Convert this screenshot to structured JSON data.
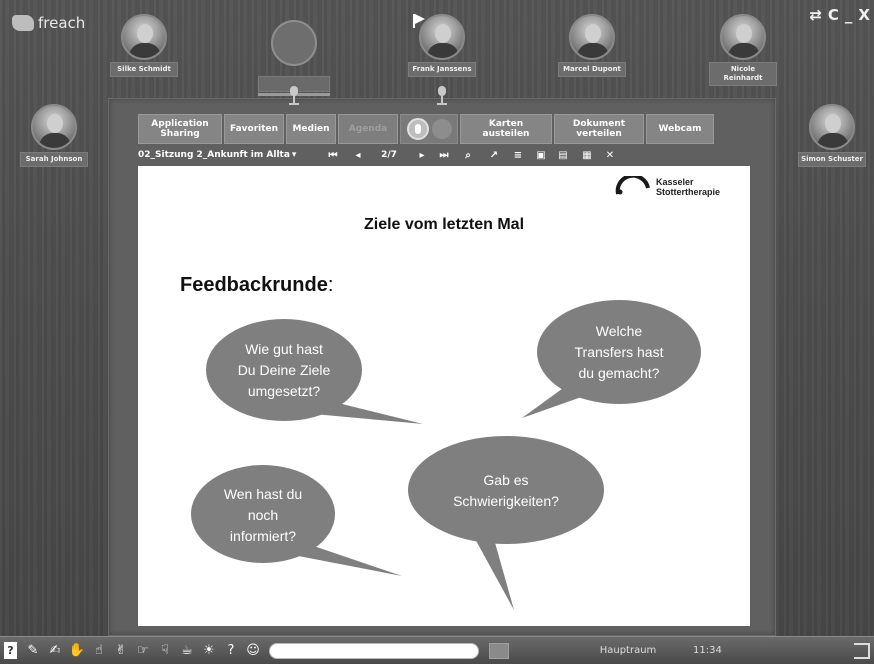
{
  "app": {
    "logo_text": "freach"
  },
  "window_controls": {
    "swap": "⇄",
    "refresh": "C",
    "minimize": "_",
    "close": "X"
  },
  "participants": {
    "top": [
      {
        "name": "Silke Schmidt"
      },
      {
        "name": "Frank Janssens"
      },
      {
        "name": "Marcel Dupont"
      },
      {
        "name": "Nicole Reinhardt"
      }
    ],
    "left": {
      "name": "Sarah Johnson"
    },
    "right": {
      "name": "Simon Schuster"
    }
  },
  "toolbar": {
    "application_sharing": "Application Sharing",
    "favoriten": "Favoriten",
    "medien": "Medien",
    "agenda": "Agenda",
    "karten": "Karten austeilen",
    "dokument": "Dokument verteilen",
    "webcam": "Webcam"
  },
  "document_nav": {
    "document_name": "02_Sitzung 2_Ankunft im Allta",
    "page_indicator": "2/7"
  },
  "slide": {
    "brand_line1": "Kasseler",
    "brand_line2": "Stottertherapie",
    "title": "Ziele vom letzten Mal",
    "subtitle": "Feedbackrunde",
    "subtitle_colon": ":",
    "bubbles": [
      {
        "line1": "Wie gut hast",
        "line2": "Du Deine Ziele",
        "line3": "umgesetzt?"
      },
      {
        "line1": "Welche",
        "line2": "Transfers hast",
        "line3": "du gemacht?"
      },
      {
        "line1": "Wen hast du",
        "line2": "noch",
        "line3": "informiert?"
      },
      {
        "line1": "Gab es",
        "line2": "Schwierigkeiten?"
      }
    ],
    "bubble_color": "#7f7f7f"
  },
  "taskbar": {
    "room": "Hauptraum",
    "time": "11:34",
    "chat_placeholder": ""
  }
}
